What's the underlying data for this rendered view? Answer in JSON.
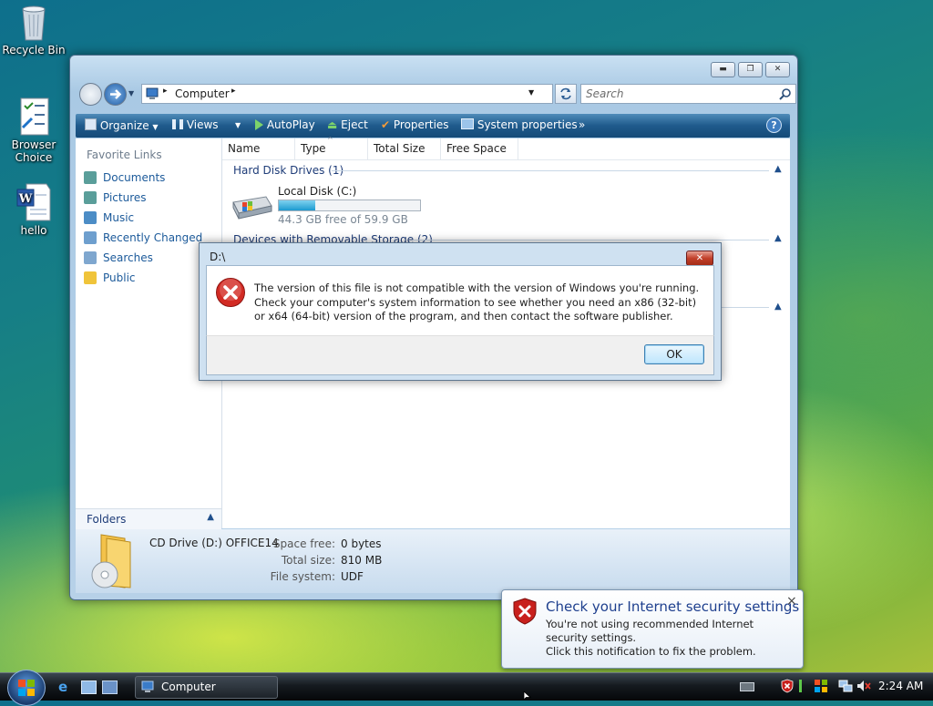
{
  "desktop": {
    "icons": [
      {
        "label": "Recycle Bin",
        "icon": "recycle-bin-icon"
      },
      {
        "label": "Browser Choice",
        "icon": "browser-choice-icon"
      },
      {
        "label": "hello",
        "icon": "word-document-icon"
      }
    ]
  },
  "explorer": {
    "address": {
      "crumb": "Computer"
    },
    "search": {
      "placeholder": "Search"
    },
    "toolbar": {
      "organize": "Organize",
      "views": "Views",
      "autoplay": "AutoPlay",
      "eject": "Eject",
      "properties": "Properties",
      "system_properties": "System properties",
      "more": "»"
    },
    "nav": {
      "heading": "Favorite Links",
      "items": [
        "Documents",
        "Pictures",
        "Music",
        "Recently Changed",
        "Searches",
        "Public"
      ],
      "folders_label": "Folders"
    },
    "columns": [
      "Name",
      "Type",
      "Total Size",
      "Free Space"
    ],
    "groups": {
      "hard_disks": "Hard Disk Drives (1)",
      "removable": "Devices with Removable Storage (2)"
    },
    "disk": {
      "name": "Local Disk (C:)",
      "free_text": "44.3 GB free of 59.9 GB",
      "used_fraction": 0.26
    },
    "details": {
      "title": "CD Drive (D:) OFFICE14",
      "space_free_label": "Space free:",
      "space_free_value": "0 bytes",
      "total_size_label": "Total size:",
      "total_size_value": "810 MB",
      "file_system_label": "File system:",
      "file_system_value": "UDF"
    }
  },
  "dialog": {
    "title": "D:\\",
    "message": "The version of this file is not compatible with the version of Windows you're running. Check your computer's system information to see whether you need an x86 (32-bit) or x64 (64-bit) version of the program, and then contact the software publisher.",
    "ok": "OK"
  },
  "notification": {
    "title": "Check your Internet security settings",
    "line1": "You're not using recommended Internet security settings.",
    "line2": "Click this notification to fix the problem.",
    "close": "×"
  },
  "taskbar": {
    "task_label": "Computer",
    "clock": "2:24 AM"
  },
  "colors": {
    "accent": "#1f5a8c",
    "link": "#1c5a9a",
    "error": "#c8201d"
  }
}
